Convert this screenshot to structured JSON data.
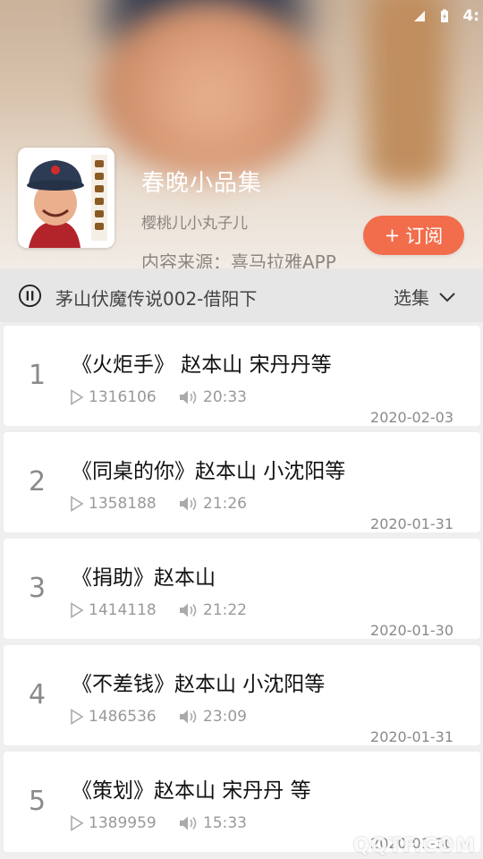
{
  "status_bar": {
    "time": "4:"
  },
  "album": {
    "title": "春晚小品集",
    "author": "樱桃儿小丸子儿",
    "source": "内容来源：喜马拉雅APP",
    "subscribe_label": "订阅",
    "subscribe_prefix": "+"
  },
  "now_playing": {
    "title": "茅山伏魔传说002-借阳下",
    "select_label": "选集"
  },
  "episodes": [
    {
      "index": "1",
      "title": "《火炬手》 赵本山 宋丹丹等",
      "plays": "1316106",
      "duration": "20:33",
      "date": "2020-02-03"
    },
    {
      "index": "2",
      "title": "《同桌的你》赵本山 小沈阳等",
      "plays": "1358188",
      "duration": "21:26",
      "date": "2020-01-31"
    },
    {
      "index": "3",
      "title": "《捐助》赵本山",
      "plays": "1414118",
      "duration": "21:22",
      "date": "2020-01-30"
    },
    {
      "index": "4",
      "title": "《不差钱》赵本山 小沈阳等",
      "plays": "1486536",
      "duration": "23:09",
      "date": "2020-01-31"
    },
    {
      "index": "5",
      "title": "《策划》赵本山 宋丹丹 等",
      "plays": "1389959",
      "duration": "15:33",
      "date": "2020-01-30"
    }
  ],
  "watermark": "QQTF.COM",
  "colors": {
    "accent": "#f26d4b",
    "nowbar_bg": "#e6e6e6"
  }
}
